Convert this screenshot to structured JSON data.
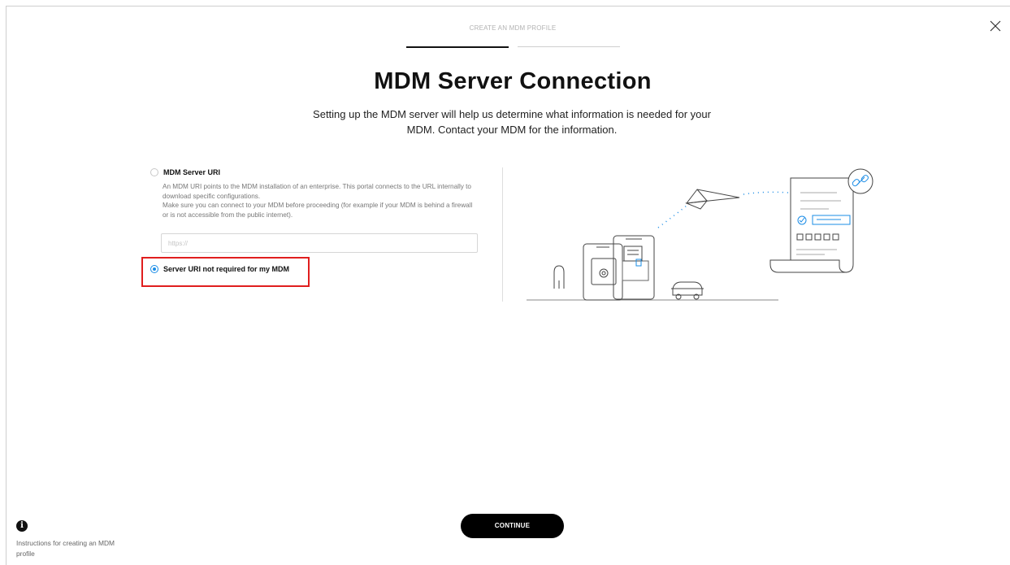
{
  "wizard": {
    "step_title": "CREATE AN MDM PROFILE",
    "progress": {
      "current_step": 1,
      "total_steps": 2
    }
  },
  "main": {
    "heading": "MDM Server Connection",
    "subtitle": "Setting up the MDM server will help us determine what information is needed for your MDM. Contact your MDM for the information."
  },
  "options": {
    "server_uri": {
      "label": "MDM Server URI",
      "checked": false,
      "description_line1": "An MDM URI points to the MDM installation of an enterprise. This portal connects to the URL internally to download specific configurations.",
      "description_line2": "Make sure you can connect to your MDM before proceeding (for example if your MDM is behind a firewall or is not accessible from the public internet).",
      "input_placeholder": "https://",
      "input_value": ""
    },
    "not_required": {
      "label": "Server URI not required for my MDM",
      "checked": true
    }
  },
  "footer": {
    "continue_label": "CONTINUE",
    "info_text": "Instructions for creating an MDM profile"
  },
  "icons": {
    "close": "close-icon",
    "info": "info-icon",
    "illustration": "server-connection-illustration"
  },
  "colors": {
    "accent": "#1a8ce6",
    "highlight": "#e01e1e",
    "primary_button": "#000000"
  }
}
